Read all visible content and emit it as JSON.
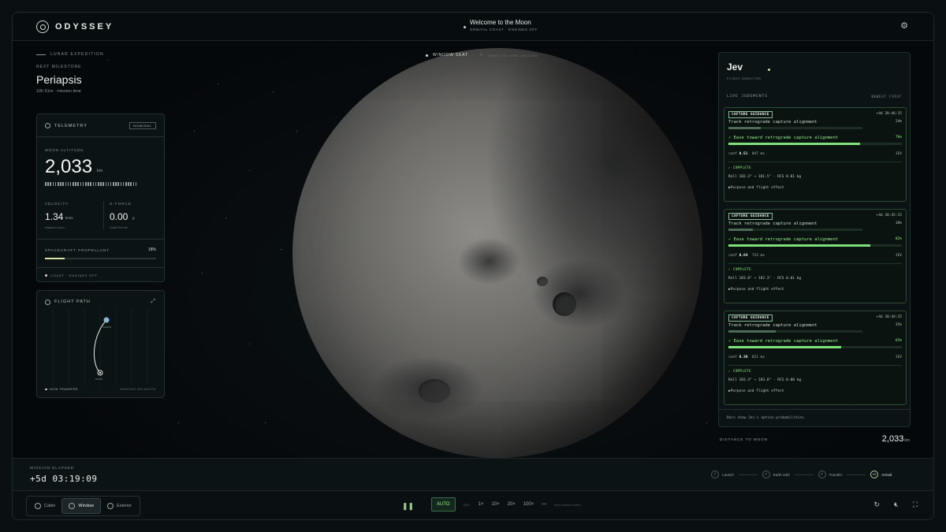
{
  "app": {
    "logo_text": "ODYSSEY",
    "title": "Welcome to the Moon",
    "subtitle": "ORBITAL COAST · ENGINES OFF"
  },
  "expedition": {
    "label": "LUNAR EXPEDITION",
    "milestone_label": "NEXT MILESTONE",
    "milestone": "Periapsis",
    "milestone_time": "10h 51m · mission time"
  },
  "telemetry": {
    "title": "TELEMETRY",
    "status": "NOMINAL",
    "altitude_label": "MOON ALTITUDE",
    "altitude": "2,033",
    "altitude_unit": "km",
    "velocity_label": "VELOCITY",
    "velocity": "1.34",
    "velocity_unit": "km/s",
    "velocity_sub": "relative to Moon",
    "gforce_label": "G-FORCE",
    "gforce": "0.00",
    "gforce_unit": "g",
    "gforce_sub": "Coast Free fall",
    "propellant_label": "SPACECRAFT PROPELLANT",
    "propellant": "18%",
    "propellant_fraction": 0.18,
    "status_line": "COAST · ENGINES OFF"
  },
  "flight_path": {
    "title": "FLIGHT PATH",
    "earth_label": "EARTH",
    "moon_label": "MOON",
    "transfer": "100% TRANSFER",
    "balanced": "RANGING BALANCED"
  },
  "window_seat": {
    "label": "WINDOW SEAT",
    "hint": "DRAG TO LOOK AROUND"
  },
  "director": {
    "name": "Jev",
    "role": "FLIGHT DIRECTOR",
    "live_label": "LIVE JUDGMENTS",
    "order": "NEWEST FIRST",
    "cards": [
      {
        "tag": "CAPTURE GUIDANCE",
        "time": "+4d 20:46:15",
        "option1": "Track retrograde capture alignment",
        "p1": "24%",
        "f1": 0.24,
        "option2": "Ease toward retrograde capture alignment",
        "p2": "76%",
        "f2": 0.76,
        "conf_label": "conf",
        "conf": "0.51",
        "latency": "847 ms",
        "author": "JEV",
        "complete": "COMPLETE",
        "roll": "Roll 182.3° → 181.5° · RCS 0.01 kg",
        "purpose": "Purpose and flight effect"
      },
      {
        "tag": "CAPTURE GUIDANCE",
        "time": "+4d 20:45:15",
        "option1": "Track retrograde capture alignment",
        "p1": "18%",
        "f1": 0.18,
        "option2": "Ease toward retrograde capture alignment",
        "p2": "82%",
        "f2": 0.82,
        "conf_label": "conf",
        "conf": "0.64",
        "latency": "713 ms",
        "author": "JEV",
        "complete": "COMPLETE",
        "roll": "Roll 183.0° → 182.3° · RCS 0.01 kg",
        "purpose": "Purpose and flight effect"
      },
      {
        "tag": "CAPTURE GUIDANCE",
        "time": "+4d 20:44:15",
        "option1": "Track retrograde capture alignment",
        "p1": "35%",
        "f1": 0.35,
        "option2": "Ease toward retrograde capture alignment",
        "p2": "65%",
        "f2": 0.65,
        "conf_label": "conf",
        "conf": "0.30",
        "latency": "811 ms",
        "author": "JEV",
        "complete": "COMPLETE",
        "roll": "Roll 183.4° → 183.0° · RCS 0.00 kg",
        "purpose": "Purpose and flight effect"
      }
    ],
    "note": "Bars show Jev's option probabilities."
  },
  "distance": {
    "label": "DISTANCE TO MOON",
    "value": "2,033",
    "unit": "km"
  },
  "mission": {
    "elapsed_label": "MISSION ELAPSED",
    "elapsed": "+5d 03:19:09"
  },
  "stages": [
    {
      "label": "Launch",
      "icon": "check-icon",
      "done": true
    },
    {
      "label": "Earth orbit",
      "icon": "check-icon",
      "done": true
    },
    {
      "label": "Transfer",
      "icon": "check-icon",
      "done": true
    },
    {
      "label": "Arrival",
      "icon": "arrival-badge",
      "badge": "04",
      "done": false,
      "active": true
    }
  ],
  "views": [
    {
      "label": "Cabin"
    },
    {
      "label": "Window",
      "active": true
    },
    {
      "label": "Exterior"
    }
  ],
  "speeds": {
    "auto": "AUTO",
    "slow": "600×",
    "s1": "1×",
    "s10": "10×",
    "s20": "20×",
    "s100": "100×",
    "skip_hint": "Next mission event"
  },
  "colors": {
    "accent": "#9bf08f",
    "panel_border": "#243033",
    "background": "#060a0c"
  }
}
